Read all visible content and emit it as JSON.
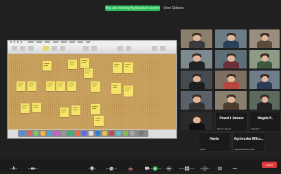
{
  "top_bar": {
    "banner": "You are viewing Agnieszka's screen",
    "view_options": "View Options"
  },
  "shared_screen": {
    "note_colors": {
      "note": "#f4e46a",
      "cork": "#c9a25f"
    }
  },
  "gallery": {
    "tiles": [
      {
        "label": ""
      },
      {
        "label": ""
      },
      {
        "label": ""
      },
      {
        "label": ""
      },
      {
        "label": ""
      },
      {
        "label": ""
      },
      {
        "label": ""
      },
      {
        "label": ""
      },
      {
        "label": ""
      },
      {
        "label": ""
      },
      {
        "label": ""
      },
      {
        "label": ""
      },
      {
        "label": ""
      },
      {
        "label": ""
      },
      {
        "label": ""
      }
    ],
    "name_tiles": [
      {
        "name": "Paweł i Janusz",
        "sub": "Paweł i Janusz"
      },
      {
        "name": "Magda K.",
        "sub": "Magda K."
      },
      {
        "name": "Hania",
        "sub": "Hania"
      },
      {
        "name": "Agnieszka Wilcz...",
        "sub": "Agnieszka Wilczynska"
      }
    ]
  },
  "controls": {
    "items": [
      {
        "label": "Unmute",
        "icon": "microphone-icon"
      },
      {
        "label": "Start Video",
        "icon": "camera-icon"
      },
      {
        "label": "Security",
        "icon": "shield-icon"
      },
      {
        "label": "Participants",
        "icon": "participants-icon"
      },
      {
        "label": "Polls",
        "icon": "poll-icon"
      },
      {
        "label": "Chat",
        "icon": "chat-icon"
      },
      {
        "label": "Share Screen",
        "icon": "share-screen-icon"
      },
      {
        "label": "Record",
        "icon": "record-icon"
      },
      {
        "label": "Breakout Rooms",
        "icon": "breakout-rooms-icon"
      },
      {
        "label": "Reactions",
        "icon": "reactions-icon"
      },
      {
        "label": "Apps",
        "icon": "apps-icon"
      },
      {
        "label": "More",
        "icon": "more-icon"
      }
    ],
    "leave": "Leave"
  }
}
